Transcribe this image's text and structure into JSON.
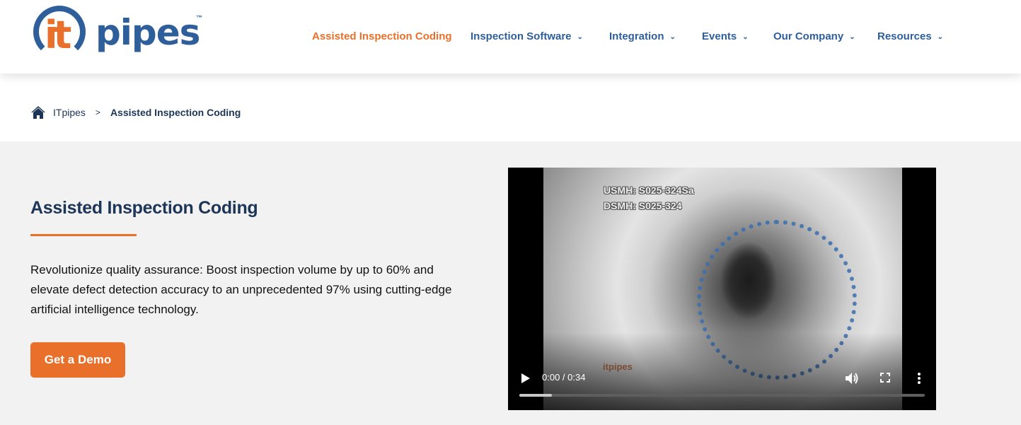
{
  "brand": {
    "logo_mark": "it",
    "logo_text": "pipes",
    "trademark": "™",
    "colors": {
      "blue": "#2f5f9b",
      "orange": "#e8702a",
      "navy": "#1d3557"
    }
  },
  "nav": {
    "items": [
      {
        "label": "Assisted Inspection Coding",
        "active": true,
        "has_dropdown": false
      },
      {
        "label": "Inspection Software",
        "active": false,
        "has_dropdown": true
      },
      {
        "label": "Integration",
        "active": false,
        "has_dropdown": true
      },
      {
        "label": "Events",
        "active": false,
        "has_dropdown": true
      },
      {
        "label": "Our Company",
        "active": false,
        "has_dropdown": true
      },
      {
        "label": "Resources",
        "active": false,
        "has_dropdown": true
      }
    ],
    "dropdown_icon": "chevron-down-icon"
  },
  "breadcrumb": {
    "home_icon": "home-icon",
    "root": "ITpipes",
    "separator": ">",
    "current": "Assisted Inspection Coding"
  },
  "hero": {
    "title": "Assisted Inspection Coding",
    "description": "Revolutionize quality assurance: Boost inspection volume by up to 60% and elevate defect detection accuracy to an unprecedented 97% using cutting-edge artificial intelligence technology.",
    "cta_label": "Get a Demo"
  },
  "video": {
    "overlay_line1": "USMH: S025-324Sa",
    "overlay_line2": "DSMH: S025-324",
    "watermark": "itpipes",
    "current_time": "0:00",
    "duration": "0:34",
    "time_display": "0:00 / 0:34",
    "buffered_fraction": 0.08,
    "controls": [
      "play-icon",
      "volume-icon",
      "fullscreen-icon",
      "more-options-icon"
    ]
  }
}
